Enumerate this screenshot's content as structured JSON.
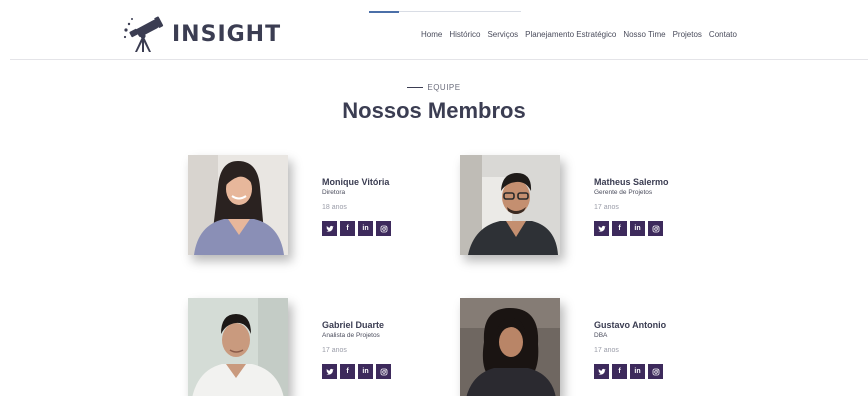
{
  "brand": {
    "name": "INSIGHT",
    "icon": "telescope-icon",
    "color": "#3b3d52"
  },
  "nav": [
    {
      "label": "Home"
    },
    {
      "label": "Histórico"
    },
    {
      "label": "Serviços"
    },
    {
      "label": "Planejamento Estratégico"
    },
    {
      "label": "Nosso Time"
    },
    {
      "label": "Projetos"
    },
    {
      "label": "Contato"
    }
  ],
  "section": {
    "eyebrow": "EQUIPE",
    "title": "Nossos Membros"
  },
  "members": [
    {
      "name": "Monique Vitória",
      "role": "Diretora",
      "age": "18 anos"
    },
    {
      "name": "Matheus Salermo",
      "role": "Gerente de Projetos",
      "age": "17 anos"
    },
    {
      "name": "Gabriel Duarte",
      "role": "Analista de Projetos",
      "age": "17 anos"
    },
    {
      "name": "Gustavo Antonio",
      "role": "DBA",
      "age": "17 anos"
    }
  ],
  "social": {
    "icons": [
      "twitter-icon",
      "facebook-icon",
      "linkedin-icon",
      "instagram-icon"
    ],
    "facebook_glyph": "f",
    "linkedin_glyph": "in",
    "button_color": "#3d2a5c"
  }
}
